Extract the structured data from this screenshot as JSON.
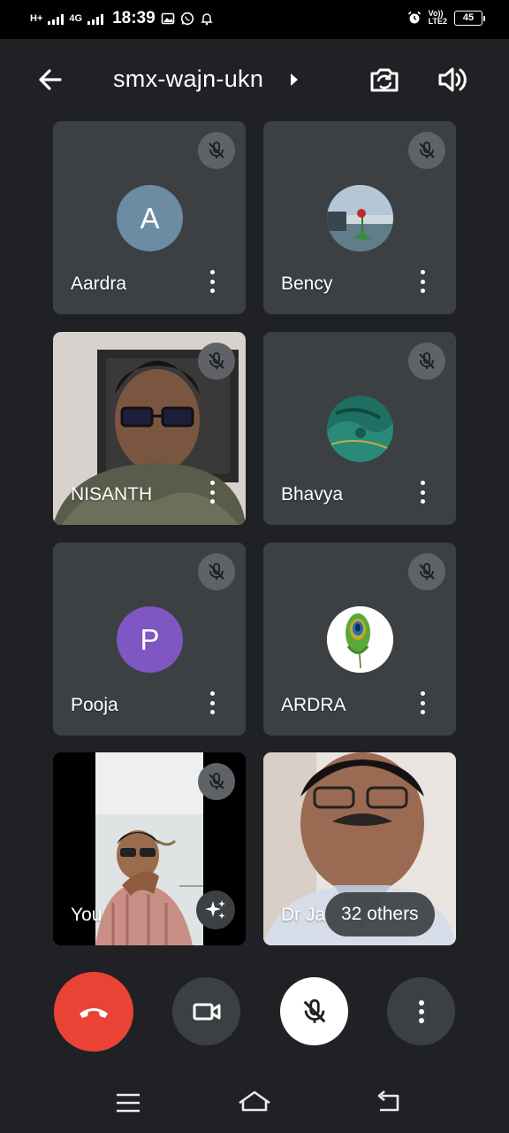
{
  "status_bar": {
    "network_top": "H+",
    "network_mid": "4G",
    "time": "18:39",
    "volte_top": "Vo))",
    "volte_bottom": "LTE2",
    "battery": "45"
  },
  "header": {
    "meeting_code": "smx-wajn-ukn"
  },
  "participants": [
    {
      "name": "Aardra",
      "initial": "A",
      "avatar_color": "#6c8ca3",
      "muted": true
    },
    {
      "name": "Bency",
      "avatar": "photo-flower",
      "muted": true
    },
    {
      "name": "NISANTH",
      "video": true,
      "muted": true
    },
    {
      "name": "Bhavya",
      "avatar": "photo-green-fabric",
      "muted": true
    },
    {
      "name": "Pooja",
      "initial": "P",
      "avatar_color": "#7e57c2",
      "muted": true
    },
    {
      "name": "ARDRA",
      "avatar": "photo-peacock-feather",
      "muted": true
    },
    {
      "name": "You",
      "video": true,
      "muted": true
    },
    {
      "name": "Dr Ja",
      "video": true
    }
  ],
  "others_badge": "32 others",
  "controls": {
    "end_call_color": "#ea4335",
    "camera": "video-camera-icon",
    "mic": "mic-off-icon",
    "more": "more-vertical-icon"
  }
}
